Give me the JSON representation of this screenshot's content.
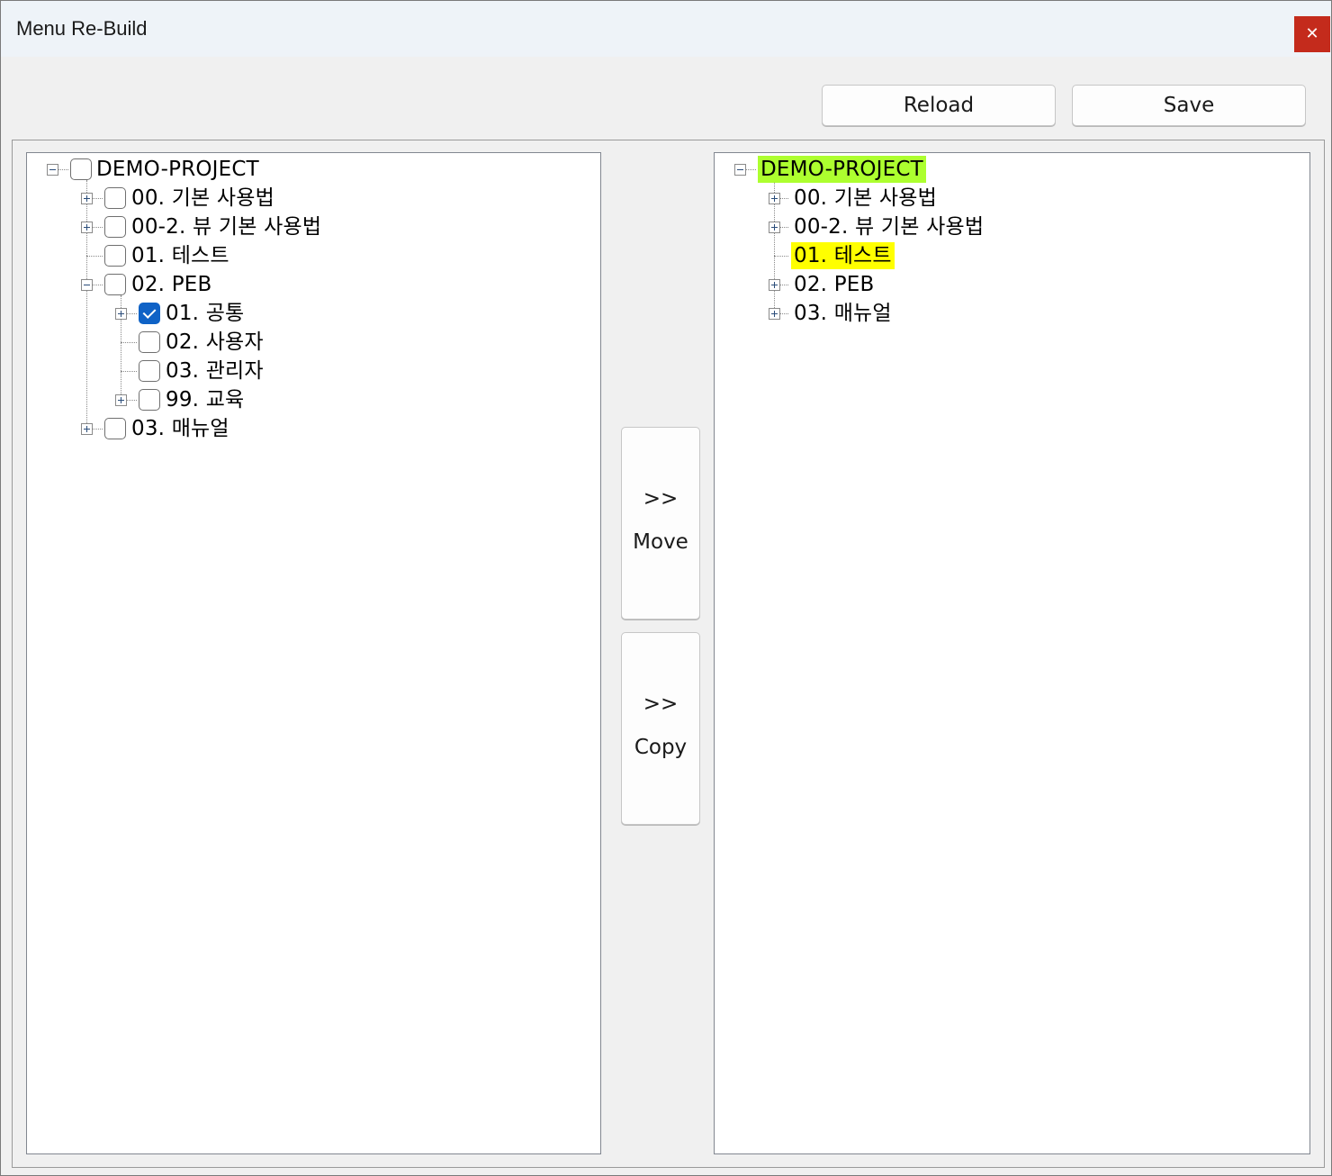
{
  "window": {
    "title": "Menu Re-Build",
    "close_label": "✕"
  },
  "toolbar": {
    "reload_label": "Reload",
    "save_label": "Save"
  },
  "actions": {
    "move": {
      "arrows": ">>",
      "label": "Move"
    },
    "copy": {
      "arrows": ">>",
      "label": "Copy"
    }
  },
  "source_tree": {
    "root": {
      "label": "DEMO-PROJECT",
      "checked": false,
      "expanded": true
    },
    "items": [
      {
        "label": "00. 기본 사용법",
        "checked": false,
        "expandable": true
      },
      {
        "label": "00-2. 뷰 기본 사용법",
        "checked": false,
        "expandable": true
      },
      {
        "label": "01. 테스트",
        "checked": false,
        "expandable": false
      },
      {
        "label": "02. PEB",
        "checked": false,
        "expandable": true,
        "expanded": true,
        "children": [
          {
            "label": "01. 공통",
            "checked": true,
            "expandable": true
          },
          {
            "label": "02. 사용자",
            "checked": false,
            "expandable": false
          },
          {
            "label": "03. 관리자",
            "checked": false,
            "expandable": false
          },
          {
            "label": "99. 교육",
            "checked": false,
            "expandable": true
          }
        ]
      },
      {
        "label": "03. 매뉴얼",
        "checked": false,
        "expandable": true
      }
    ]
  },
  "target_tree": {
    "root": {
      "label": "DEMO-PROJECT",
      "highlight": "#adff2f",
      "expanded": true
    },
    "items": [
      {
        "label": "00. 기본 사용법",
        "expandable": true
      },
      {
        "label": "00-2. 뷰 기본 사용법",
        "expandable": true
      },
      {
        "label": "01. 테스트",
        "expandable": false,
        "highlight": "#ffff00"
      },
      {
        "label": "02. PEB",
        "expandable": true
      },
      {
        "label": "03. 매뉴얼",
        "expandable": true
      }
    ]
  }
}
